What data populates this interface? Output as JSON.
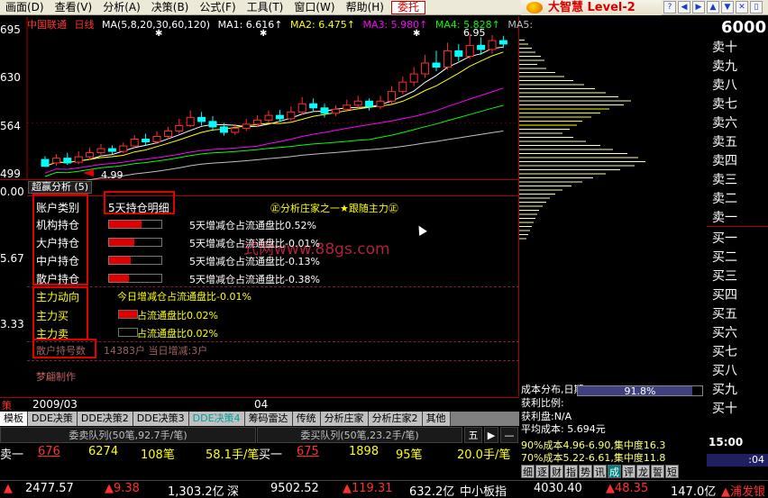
{
  "menu": {
    "items": [
      "画面(D)",
      "查看(V)",
      "分析(A)",
      "决策(B)",
      "公式(F)",
      "工具(T)",
      "窗口(W)",
      "帮助(H)"
    ],
    "active_item": "委托",
    "brand": "大智慧 Level-2",
    "toolbar_icons": [
      "help-icon",
      "arrow-left-icon",
      "arrow-right-icon",
      "arrow-up-icon",
      "arrow-down-icon",
      "close-window-icon",
      "folder-icon"
    ]
  },
  "chart": {
    "stock_name": "中国联通",
    "period": "日线",
    "ma_formula": "MA(5,8,20,30,60,120)",
    "ma1": "MA1: 6.616↑",
    "ma2": "MA2: 6.475↑",
    "ma3": "MA3: 5.980↑",
    "ma4": "MA4: 5.828↑",
    "ma5": "MA5:",
    "yaxis": [
      "695",
      "630",
      "564",
      "499"
    ],
    "high_label": "6.95",
    "low_label": "4.99",
    "price_right": "6000",
    "colors": {
      "up": "#ff3030",
      "down": "#00ffff",
      "ma1": "#ffffff",
      "ma2": "#ffff00",
      "ma3": "#ff00ff",
      "ma4": "#00ff00",
      "ma5": "#c0c0c0"
    },
    "candles": [
      {
        "o": 5.1,
        "c": 5.0,
        "h": 5.15,
        "l": 4.99
      },
      {
        "o": 5.05,
        "c": 5.12,
        "h": 5.18,
        "l": 5.01
      },
      {
        "o": 5.12,
        "c": 5.05,
        "h": 5.2,
        "l": 5.02
      },
      {
        "o": 5.06,
        "c": 5.14,
        "h": 5.22,
        "l": 5.03
      },
      {
        "o": 5.14,
        "c": 5.2,
        "h": 5.28,
        "l": 5.1
      },
      {
        "o": 5.2,
        "c": 5.26,
        "h": 5.33,
        "l": 5.15
      },
      {
        "o": 5.26,
        "c": 5.22,
        "h": 5.31,
        "l": 5.18
      },
      {
        "o": 5.22,
        "c": 5.3,
        "h": 5.35,
        "l": 5.19
      },
      {
        "o": 5.3,
        "c": 5.4,
        "h": 5.46,
        "l": 5.26
      },
      {
        "o": 5.4,
        "c": 5.36,
        "h": 5.48,
        "l": 5.3
      },
      {
        "o": 5.36,
        "c": 5.44,
        "h": 5.52,
        "l": 5.33
      },
      {
        "o": 5.44,
        "c": 5.52,
        "h": 5.58,
        "l": 5.4
      },
      {
        "o": 5.52,
        "c": 5.6,
        "h": 5.7,
        "l": 5.48
      },
      {
        "o": 5.6,
        "c": 5.72,
        "h": 5.82,
        "l": 5.58
      },
      {
        "o": 5.72,
        "c": 5.66,
        "h": 5.8,
        "l": 5.6
      },
      {
        "o": 5.66,
        "c": 5.58,
        "h": 5.74,
        "l": 5.52
      },
      {
        "o": 5.58,
        "c": 5.5,
        "h": 5.64,
        "l": 5.45
      },
      {
        "o": 5.5,
        "c": 5.56,
        "h": 5.62,
        "l": 5.46
      },
      {
        "o": 5.56,
        "c": 5.62,
        "h": 5.7,
        "l": 5.52
      },
      {
        "o": 5.62,
        "c": 5.68,
        "h": 5.75,
        "l": 5.58
      },
      {
        "o": 5.68,
        "c": 5.75,
        "h": 5.82,
        "l": 5.63
      },
      {
        "o": 5.75,
        "c": 5.7,
        "h": 5.83,
        "l": 5.66
      },
      {
        "o": 5.7,
        "c": 5.8,
        "h": 5.88,
        "l": 5.67
      },
      {
        "o": 5.8,
        "c": 5.92,
        "h": 6.02,
        "l": 5.76
      },
      {
        "o": 5.92,
        "c": 5.86,
        "h": 6.0,
        "l": 5.8
      },
      {
        "o": 5.86,
        "c": 5.78,
        "h": 5.92,
        "l": 5.72
      },
      {
        "o": 5.78,
        "c": 5.84,
        "h": 5.9,
        "l": 5.74
      },
      {
        "o": 5.84,
        "c": 5.9,
        "h": 5.98,
        "l": 5.8
      },
      {
        "o": 5.9,
        "c": 5.96,
        "h": 6.04,
        "l": 5.86
      },
      {
        "o": 5.96,
        "c": 5.88,
        "h": 6.0,
        "l": 5.82
      },
      {
        "o": 5.88,
        "c": 5.96,
        "h": 6.04,
        "l": 5.84
      },
      {
        "o": 5.96,
        "c": 6.1,
        "h": 6.18,
        "l": 5.92
      },
      {
        "o": 6.1,
        "c": 6.24,
        "h": 6.32,
        "l": 6.06
      },
      {
        "o": 6.24,
        "c": 6.36,
        "h": 6.46,
        "l": 6.18
      },
      {
        "o": 6.36,
        "c": 6.52,
        "h": 6.64,
        "l": 6.3
      },
      {
        "o": 6.52,
        "c": 6.46,
        "h": 6.7,
        "l": 6.4
      },
      {
        "o": 6.46,
        "c": 6.7,
        "h": 6.82,
        "l": 6.42
      },
      {
        "o": 6.7,
        "c": 6.62,
        "h": 6.8,
        "l": 6.55
      },
      {
        "o": 6.62,
        "c": 6.78,
        "h": 6.95,
        "l": 6.58
      },
      {
        "o": 6.78,
        "c": 6.72,
        "h": 6.9,
        "l": 6.64
      },
      {
        "o": 6.72,
        "c": 6.85,
        "h": 6.93,
        "l": 6.66
      },
      {
        "o": 6.85,
        "c": 6.8,
        "h": 6.92,
        "l": 6.74
      }
    ]
  },
  "panel": {
    "title": "超赢分析 (5)",
    "axis": [
      "0.00",
      "5.67",
      "3.33",
      ""
    ],
    "header_left": "账户类别",
    "header_right": "5天持仓明细",
    "center_note": "㊣分析庄家之一★跟随主力㊣",
    "watermark": "式网www.88gs.com",
    "rows": [
      {
        "label": "机构持仓",
        "pct": 0.62,
        "text": "5天增减仓占流通盘比0.52%"
      },
      {
        "label": "大户持仓",
        "pct": 0.48,
        "text": "5天增减仓占流通盘比-0.01%"
      },
      {
        "label": "中户持仓",
        "pct": 0.42,
        "text": "5天增减仓占流通盘比-0.13%"
      },
      {
        "label": "散户持仓",
        "pct": 0.38,
        "text": "5天增减仓占流通盘比-0.38%"
      }
    ],
    "main_trend_label": "主力动向",
    "main_trend_text": "今日增减仓占流通盘比-0.01%",
    "main_buy_label": "主力买",
    "main_buy_text": "占流通盘比0.02%",
    "main_sell_label": "主力卖",
    "main_sell_text": "占流通盘比0.02%",
    "retail_label": "散户持号数",
    "retail_text": "14383户 当日增减:3户",
    "author": "梦翩制作"
  },
  "dates": [
    "2009/03",
    "04"
  ],
  "tabs": [
    "模板",
    "DDE决策",
    "DDE决策2",
    "DDE决策3",
    "DDE决策4",
    "筹码雷达",
    "传统",
    "分析庄家",
    "分析庄家2",
    "其他"
  ],
  "queues": {
    "sell": "委卖队列(50笔,92.7手/笔)",
    "buy": "委买队列(50笔,23.2手/笔)",
    "five": "五",
    "arrow": "▶",
    "minus": "—"
  },
  "orders": {
    "sell1_label": "卖一",
    "sell1_price": "676",
    "sell1_vol": "6274",
    "sell1_count": "108笔",
    "sell1_avg": "58.1手/笔",
    "buy1_label": "买一",
    "buy1_price": "675",
    "buy1_vol": "1898",
    "buy1_count": "95笔",
    "buy1_avg": "20.0手/笔"
  },
  "ticker": {
    "v1": "2477.57",
    "v2": "▲9.38",
    "v3": "1,303.2亿",
    "v4": "深",
    "v5": "9502.52",
    "v6": "▲119.31",
    "v7": "632.2亿",
    "v8": "中小板指",
    "v9": "4030.40",
    "v10": "▲48.35",
    "v11": "147.0亿",
    "v12": "▲浦发银"
  },
  "orderbook": {
    "sells": [
      "卖十",
      "卖九",
      "卖八",
      "卖七",
      "卖六",
      "卖五",
      "卖四",
      "卖三",
      "卖二",
      "卖一"
    ],
    "buys": [
      "买一",
      "买二",
      "买三",
      "买四",
      "买五",
      "买六",
      "买七",
      "买八",
      "买九",
      "买十"
    ]
  },
  "cost": {
    "title": "成本分布,日期: 2009/04/30",
    "profit_label": "获利比例:",
    "profit_value": "91.8%",
    "profit_fraction": 0.918,
    "profit_pan": "获利盘:N/A",
    "avg_cost": "平均成本: 5.694元",
    "c90": "90%成本4.96-6.90,集中度16.3",
    "c70": "70%成本5.22-6.61,集中度11.8",
    "buttons": [
      "细",
      "逐",
      "财",
      "指",
      "势",
      "讯",
      "成",
      "评",
      "龙",
      "誓",
      "短"
    ],
    "selected_button": "成"
  },
  "time": {
    "t1": "15:00",
    "t2": ":04"
  }
}
